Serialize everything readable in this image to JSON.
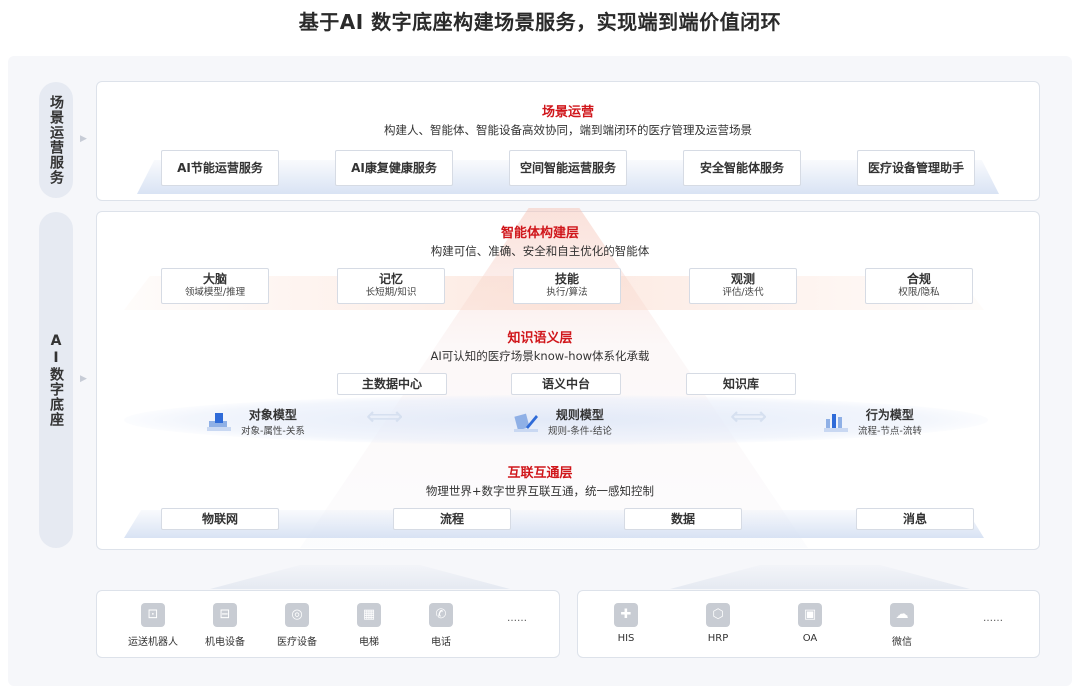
{
  "title": "基于AI 数字底座构建场景服务，实现端到端价值闭环",
  "side_labels": [
    "场景运营服务",
    "AI数字底座"
  ],
  "scene_ops": {
    "title": "场景运营",
    "subtitle": "构建人、智能体、智能设备高效协同，端到端闭环的医疗管理及运营场景",
    "services": [
      "AI节能运营服务",
      "AI康复健康服务",
      "空间智能运营服务",
      "安全智能体服务",
      "医疗设备管理助手"
    ]
  },
  "agent_layer": {
    "title": "智能体构建层",
    "subtitle": "构建可信、准确、安全和自主优化的智能体",
    "items": [
      {
        "name": "大脑",
        "desc": "领域模型/推理"
      },
      {
        "name": "记忆",
        "desc": "长短期/知识"
      },
      {
        "name": "技能",
        "desc": "执行/算法"
      },
      {
        "name": "观测",
        "desc": "评估/迭代"
      },
      {
        "name": "合规",
        "desc": "权限/隐私"
      }
    ]
  },
  "knowledge_layer": {
    "title": "知识语义层",
    "subtitle": "AI可认知的医疗场景know-how体系化承载",
    "items": [
      "主数据中心",
      "语义中台",
      "知识库"
    ],
    "models": [
      {
        "name": "对象模型",
        "desc": "对象-属性-关系",
        "icon": "object-model-icon"
      },
      {
        "name": "规则模型",
        "desc": "规则-条件-结论",
        "icon": "rule-model-icon"
      },
      {
        "name": "行为模型",
        "desc": "流程-节点-流转",
        "icon": "behavior-model-icon"
      }
    ]
  },
  "interconnect_layer": {
    "title": "互联互通层",
    "subtitle": "物理世界+数字世界互联互通，统一感知控制",
    "items": [
      "物联网",
      "流程",
      "数据",
      "消息"
    ]
  },
  "physical_sources": [
    {
      "label": "运送机器人",
      "icon": "robot-icon"
    },
    {
      "label": "机电设备",
      "icon": "electromechanical-icon"
    },
    {
      "label": "医疗设备",
      "icon": "medical-device-icon"
    },
    {
      "label": "电梯",
      "icon": "elevator-icon"
    },
    {
      "label": "电话",
      "icon": "phone-icon"
    }
  ],
  "digital_sources": [
    {
      "label": "HIS",
      "icon": "his-icon"
    },
    {
      "label": "HRP",
      "icon": "hrp-icon"
    },
    {
      "label": "OA",
      "icon": "oa-icon"
    },
    {
      "label": "微信",
      "icon": "wechat-icon"
    }
  ],
  "more": "……"
}
